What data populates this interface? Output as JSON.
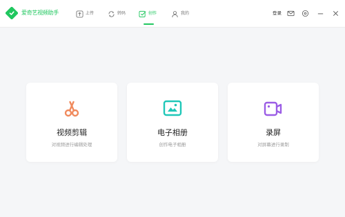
{
  "app": {
    "title": "爱奇艺视频助手",
    "brand_color": "#20c75f"
  },
  "nav": {
    "items": [
      {
        "label": "上传",
        "icon": "upload-icon",
        "active": false
      },
      {
        "label": "转码",
        "icon": "transcode-icon",
        "active": false
      },
      {
        "label": "创作",
        "icon": "create-icon",
        "active": true
      },
      {
        "label": "我的",
        "icon": "user-icon",
        "active": false
      }
    ]
  },
  "window": {
    "login_label": "登录",
    "icons": [
      "mail-icon",
      "settings-icon",
      "minimize-icon",
      "close-icon"
    ]
  },
  "cards": [
    {
      "title": "视频剪辑",
      "desc": "对视频进行编辑处理",
      "icon": "scissors-icon",
      "color": "#f08a5d"
    },
    {
      "title": "电子相册",
      "desc": "创作电子相册",
      "icon": "photo-album-icon",
      "color": "#1fc7b8"
    },
    {
      "title": "录屏",
      "desc": "对屏幕进行录制",
      "icon": "video-camera-icon",
      "color": "#9b5de5"
    }
  ]
}
